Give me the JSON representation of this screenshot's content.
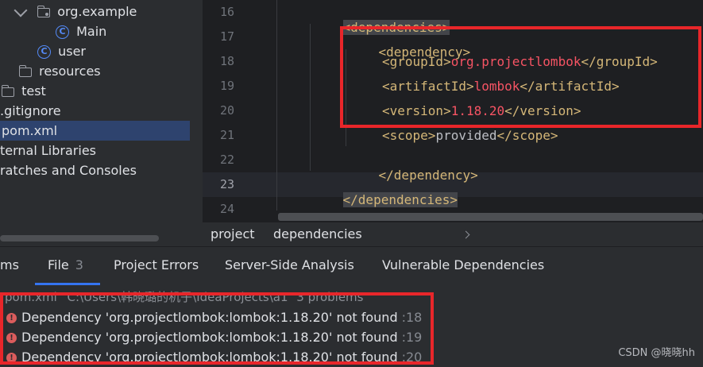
{
  "project_tree": {
    "items": [
      {
        "label": "org.example",
        "icon": "package-folder-icon",
        "expanded": true
      },
      {
        "label": "Main",
        "icon": "class-icon"
      },
      {
        "label": "user",
        "icon": "class-icon"
      },
      {
        "label": "resources",
        "icon": "resources-folder-icon"
      },
      {
        "label": "test",
        "icon": "folder-icon"
      },
      {
        "label": ".gitignore",
        "icon": ""
      },
      {
        "label": "pom.xml",
        "icon": "",
        "selected": true
      },
      {
        "label": "ternal Libraries",
        "icon": ""
      },
      {
        "label": "ratches and Consoles",
        "icon": ""
      }
    ]
  },
  "editor": {
    "line_numbers": [
      "16",
      "17",
      "18",
      "19",
      "20",
      "21",
      "22",
      "23",
      "24"
    ],
    "active_line": "23",
    "lines": {
      "l16": {
        "tag": "<dependencies>"
      },
      "l17": {
        "tag": "<dependency>"
      },
      "l18": {
        "open": "<groupId>",
        "value": "org.projectlombok",
        "close": "</groupId>"
      },
      "l19": {
        "open": "<artifactId>",
        "value": "lombok",
        "close": "</artifactId>"
      },
      "l20": {
        "open": "<version>",
        "value": "1.18.20",
        "close": "</version>"
      },
      "l21": {
        "open": "<scope>",
        "value": "provided",
        "close": "</scope>"
      },
      "l22": {
        "tag": "</dependency>"
      },
      "l23": {
        "tag": "</dependencies>"
      }
    }
  },
  "breadcrumb": {
    "items": [
      "project",
      "dependencies"
    ]
  },
  "problems_panel": {
    "tabs": [
      {
        "label": "ms"
      },
      {
        "label": "File",
        "count": "3",
        "selected": true
      },
      {
        "label": "Project Errors"
      },
      {
        "label": "Server-Side Analysis"
      },
      {
        "label": "Vulnerable Dependencies"
      }
    ],
    "file_row": {
      "name": "pom.xml",
      "path": "C:\\Users\\韩晓璐的机子\\IdeaProjects\\a1",
      "summary": "3 problems"
    },
    "problems": [
      {
        "message": "Dependency 'org.projectlombok:lombok:1.18.20' not found",
        "line": ":18"
      },
      {
        "message": "Dependency 'org.projectlombok:lombok:1.18.20' not found",
        "line": ":19"
      },
      {
        "message": "Dependency 'org.projectlombok:lombok:1.18.20' not found",
        "line": ":20"
      }
    ]
  },
  "colors": {
    "highlight_box": "#e8262a",
    "error_icon": "#db5c5c",
    "xml_tag": "#d5b778",
    "invalid_value": "#f75464",
    "selected_tab_underline": "#3574f0"
  },
  "watermark": "CSDN @晓晓hh"
}
